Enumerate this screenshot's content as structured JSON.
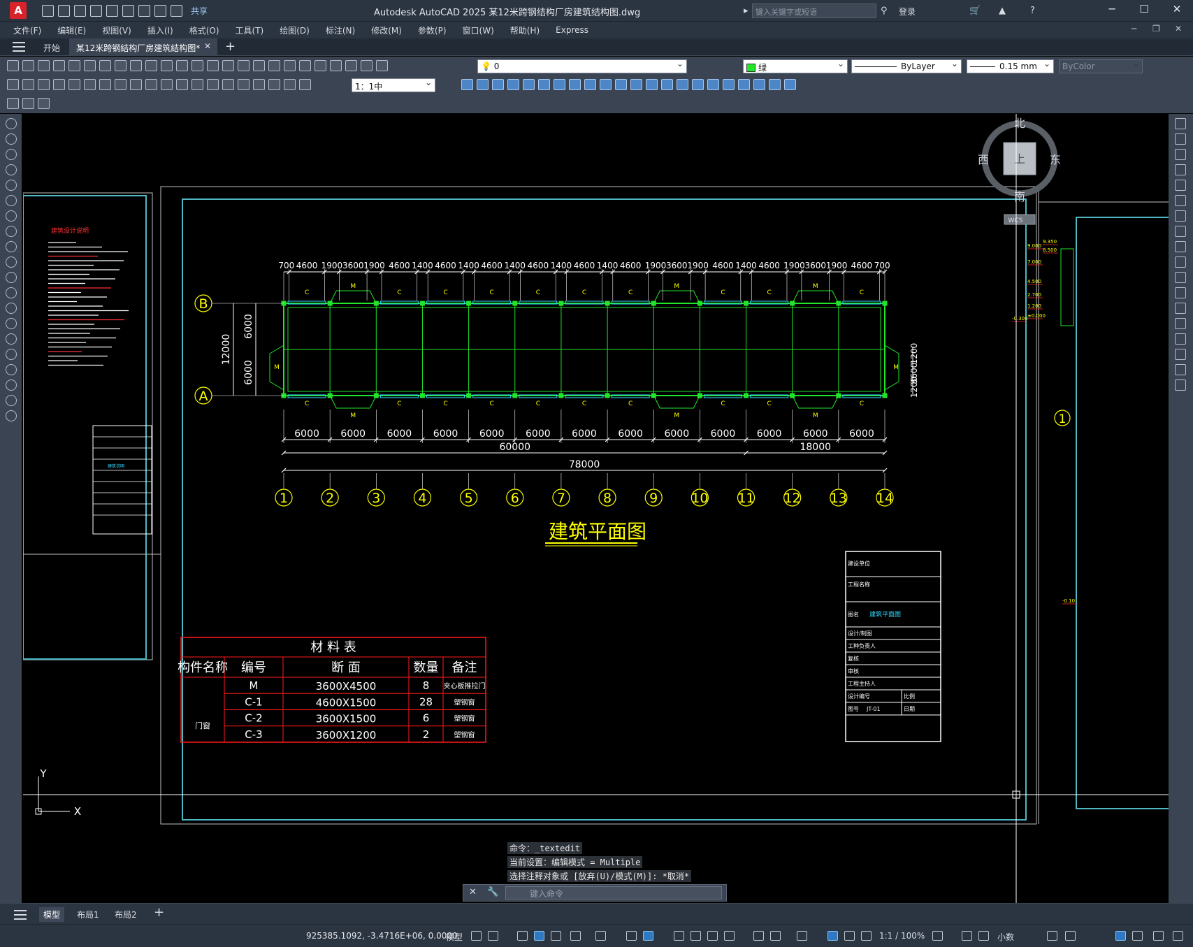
{
  "titlebar": {
    "app_icon": "A",
    "share_label": "共享",
    "title": "Autodesk AutoCAD 2025    某12米跨钢结构厂房建筑结构图.dwg",
    "search_placeholder": "键入关键字或短语",
    "login_label": "登录",
    "icons": [
      "new-icon",
      "open-icon",
      "save-icon",
      "saveas-icon",
      "plot-icon",
      "undo-icon",
      "redo-icon",
      "share-icon",
      "search-icon",
      "user-icon",
      "cart-icon",
      "autodesk-icon",
      "help-icon"
    ]
  },
  "menubar": {
    "items": [
      "文件(F)",
      "编辑(E)",
      "视图(V)",
      "插入(I)",
      "格式(O)",
      "工具(T)",
      "绘图(D)",
      "标注(N)",
      "修改(M)",
      "参数(P)",
      "窗口(W)",
      "帮助(H)",
      "Express"
    ]
  },
  "tabs": {
    "start": "开始",
    "document": "某12米跨钢结构厂房建筑结构图*"
  },
  "toolbar": {
    "layer_value": "0",
    "color_value": "绿",
    "color_hex": "#21e52a",
    "linetype_value": "ByLayer",
    "lineweight_value": "0.15 mm",
    "plotstyle_value": "ByColor",
    "scale_value": "1：1中"
  },
  "viewcube": {
    "north": "北",
    "south": "南",
    "east": "东",
    "west": "西",
    "face": "上",
    "wcs": "WCS"
  },
  "drawing": {
    "top_dims": [
      "700",
      "4600",
      "1900",
      "3600",
      "1900",
      "4600",
      "1400",
      "4600",
      "1400",
      "4600",
      "1400",
      "4600",
      "1400",
      "4600",
      "1400",
      "4600",
      "1900",
      "3600",
      "1900",
      "4600",
      "1400",
      "4600",
      "1900",
      "3600",
      "1900",
      "4600",
      "700"
    ],
    "bay_dims": [
      "6000",
      "6000",
      "6000",
      "6000",
      "6000",
      "6000",
      "6000",
      "6000",
      "6000",
      "6000",
      "6000",
      "6000",
      "6000"
    ],
    "sub_total_1": "60000",
    "sub_total_2": "18000",
    "total": "78000",
    "axes_num": [
      "1",
      "2",
      "3",
      "4",
      "5",
      "6",
      "7",
      "8",
      "9",
      "10",
      "11",
      "12",
      "13",
      "14"
    ],
    "axes_letter": [
      "B",
      "A"
    ],
    "left_dims": [
      "12000",
      "6000",
      "6000"
    ],
    "right_dims": [
      "1200",
      "3600",
      "1200"
    ],
    "title": "建筑平面图",
    "left_sheet_title": "建筑设计说明",
    "left_sheet_tag": "建筑说明",
    "win_c": "C",
    "door_m": "M",
    "right_sheet_axis": "1",
    "right_levels": [
      "9.000",
      "9.350",
      "8.500",
      "7.000",
      "4.500",
      "2.700",
      "1.200",
      "±0.000",
      "-0.300",
      "-0.10"
    ]
  },
  "material_table": {
    "title": "材    料    表",
    "headers": [
      "构件名称",
      "编号",
      "断    面",
      "数量",
      "备注"
    ],
    "group": "门窗",
    "rows": [
      {
        "code": "M",
        "section": "3600X4500",
        "qty": "8",
        "note": "夹心板推拉门"
      },
      {
        "code": "C-1",
        "section": "4600X1500",
        "qty": "28",
        "note": "塑钢窗"
      },
      {
        "code": "C-2",
        "section": "3600X1500",
        "qty": "6",
        "note": "塑钢窗"
      },
      {
        "code": "C-3",
        "section": "3600X1200",
        "qty": "2",
        "note": "塑钢窗"
      }
    ]
  },
  "title_block": {
    "rows": [
      "建设单位",
      "工程名称",
      "图名",
      "设计/制图",
      "工种负责人",
      "复核",
      "审核",
      "工程主持人",
      "设计编号",
      "图号"
    ],
    "drawing_name": "建筑平面图",
    "scale_label": "比例",
    "date_label": "日期",
    "sheet_no": "JT-01"
  },
  "ucs": {
    "x": "X",
    "y": "Y"
  },
  "command": {
    "history": [
      "命令：_textedit",
      "当前设置：编辑模式 = Multiple",
      "选择注释对象或 [放弃(U)/模式(M)]: *取消*"
    ],
    "placeholder": "键入命令"
  },
  "layout_tabs": [
    "模型",
    "布局1",
    "布局2"
  ],
  "status": {
    "coords": "925385.1092, -3.4716E+06, 0.0000",
    "model": "模型",
    "scale": "1:1 / 100%",
    "units": "小数"
  },
  "colors": {
    "sheet_border": "#4fb8c4",
    "plan_green": "#21e52a",
    "dim_white": "#ffffff",
    "axis_yellow": "#ffff00",
    "table_red": "#ff1a1a",
    "door_yellow": "#ffff00",
    "window_cyan": "#33d8ff",
    "crosshair": "#ffffff"
  }
}
